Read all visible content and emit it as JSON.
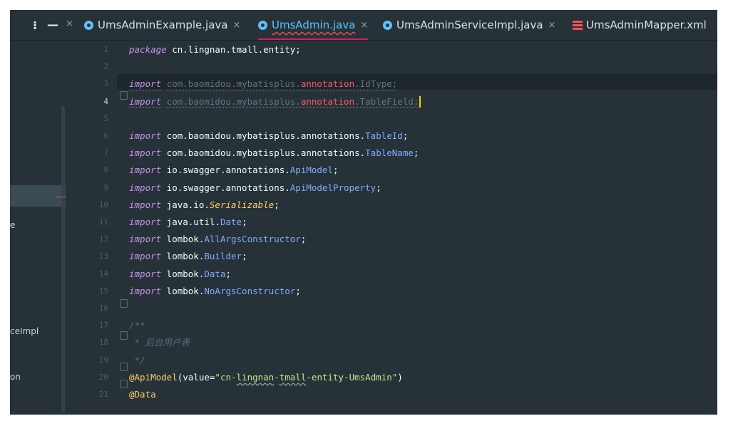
{
  "tabs": [
    {
      "label": "UmsAdminExample.java",
      "icon": "java-class-icon",
      "active": false
    },
    {
      "label": "UmsAdmin.java",
      "icon": "java-class-icon",
      "active": true
    },
    {
      "label": "UmsAdminServiceImpl.java",
      "icon": "java-class-icon",
      "active": false
    },
    {
      "label": "UmsAdminMapper.xml",
      "icon": "xml-file-icon",
      "active": false
    }
  ],
  "tab_close_glyph": "×",
  "side_fragments": [
    "e",
    "ceImpl",
    "on"
  ],
  "lines": [
    {
      "n": "1",
      "text": "package cn.lingnan.tmall.entity;"
    },
    {
      "n": "2",
      "text": ""
    },
    {
      "n": "3",
      "text": "import com.baomidou.mybatisplus.annotation.IdType;"
    },
    {
      "n": "4",
      "text": "import com.baomidou.mybatisplus.annotation.TableField;"
    },
    {
      "n": "5",
      "text": ""
    },
    {
      "n": "6",
      "text": "import com.baomidou.mybatisplus.annotations.TableId;"
    },
    {
      "n": "7",
      "text": "import com.baomidou.mybatisplus.annotations.TableName;"
    },
    {
      "n": "8",
      "text": "import io.swagger.annotations.ApiModel;"
    },
    {
      "n": "9",
      "text": "import io.swagger.annotations.ApiModelProperty;"
    },
    {
      "n": "10",
      "text": "import java.io.Serializable;"
    },
    {
      "n": "11",
      "text": "import java.util.Date;"
    },
    {
      "n": "12",
      "text": "import lombok.AllArgsConstructor;"
    },
    {
      "n": "13",
      "text": "import lombok.Builder;"
    },
    {
      "n": "14",
      "text": "import lombok.Data;"
    },
    {
      "n": "15",
      "text": "import lombok.NoArgsConstructor;"
    },
    {
      "n": "16",
      "text": ""
    },
    {
      "n": "17",
      "text": "/**"
    },
    {
      "n": "18",
      "text": " * 后台用户表"
    },
    {
      "n": "19",
      "text": " */"
    },
    {
      "n": "20",
      "text": "@ApiModel(value=\"cn-lingnan-tmall-entity-UmsAdmin\")"
    },
    {
      "n": "21",
      "text": "@Data"
    }
  ]
}
